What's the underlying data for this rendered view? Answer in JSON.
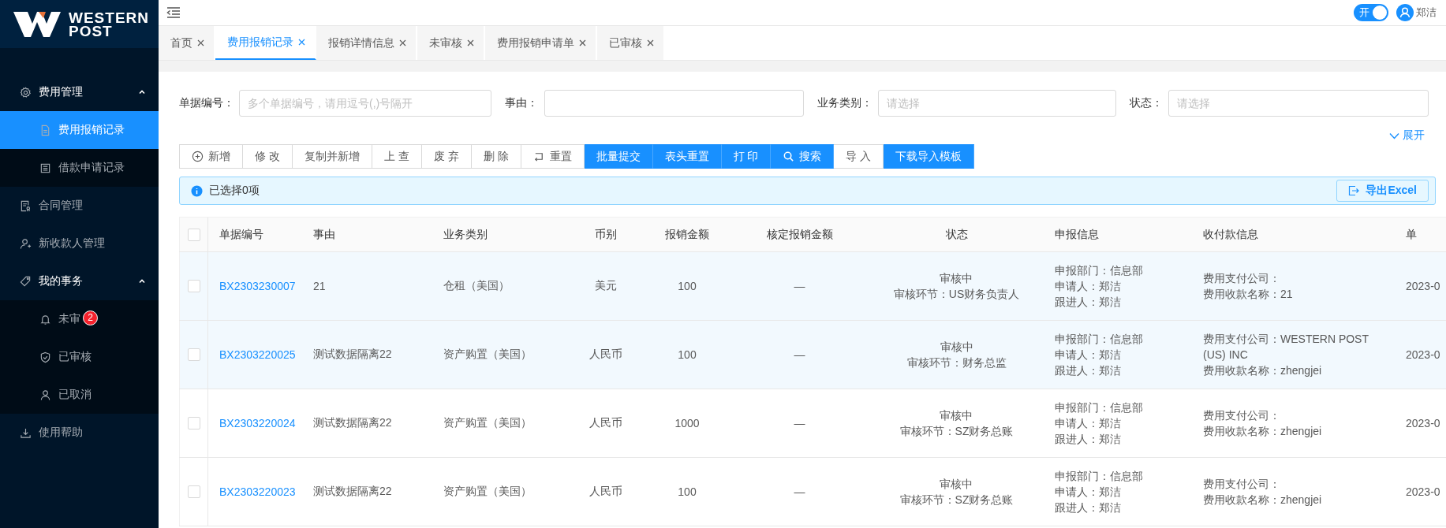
{
  "sidebar": {
    "logo": {
      "line1": "WESTERN",
      "line2": "POST"
    },
    "menu": [
      {
        "kind": "group",
        "label": "费用管理",
        "expanded": true,
        "children": [
          {
            "label": "费用报销记录",
            "selected": true
          },
          {
            "label": "借款申请记录",
            "selected": false
          }
        ]
      },
      {
        "kind": "item",
        "label": "合同管理",
        "selected": false
      },
      {
        "kind": "item",
        "label": "新收款人管理",
        "selected": false
      },
      {
        "kind": "group",
        "label": "我的事务",
        "expanded": true,
        "children": [
          {
            "label": "未审",
            "selected": false,
            "badge": "2"
          },
          {
            "label": "已审核",
            "selected": false
          },
          {
            "label": "已取消",
            "selected": false
          }
        ]
      },
      {
        "kind": "item",
        "label": "使用帮助",
        "selected": false
      }
    ]
  },
  "header": {
    "toggle": {
      "label": "开",
      "on": true
    },
    "user": {
      "name": "郑洁"
    }
  },
  "tabs": [
    {
      "label": "首页",
      "selected": false
    },
    {
      "label": "费用报销记录",
      "selected": true
    },
    {
      "label": "报销详情信息",
      "selected": false
    },
    {
      "label": "未审核",
      "selected": false
    },
    {
      "label": "费用报销申请单",
      "selected": false
    },
    {
      "label": "已审核",
      "selected": false
    }
  ],
  "filters": [
    {
      "label": "单据编号：",
      "placeholder": "多个单据编号，请用逗号(,)号隔开"
    },
    {
      "label": "事由："
    },
    {
      "label": "业务类别：",
      "placeholder": "请选择"
    },
    {
      "label": "状态：",
      "placeholder": "请选择"
    }
  ],
  "expand_link": "展开",
  "toolbar": [
    {
      "label": "新增",
      "kind": "default"
    },
    {
      "label": "修 改",
      "kind": "default"
    },
    {
      "label": "复制并新增",
      "kind": "default"
    },
    {
      "label": "上 查",
      "kind": "default"
    },
    {
      "label": "废 弃",
      "kind": "default"
    },
    {
      "label": "删 除",
      "kind": "default"
    },
    {
      "label": "重置",
      "kind": "default"
    },
    {
      "label": "批量提交",
      "kind": "primary"
    },
    {
      "label": "表头重置",
      "kind": "primary"
    },
    {
      "label": "打 印",
      "kind": "primary"
    },
    {
      "label": "搜索",
      "kind": "primary"
    },
    {
      "label": "导 入",
      "kind": "default"
    },
    {
      "label": "下载导入模板",
      "kind": "primary"
    }
  ],
  "alert": {
    "text": "已选择0项",
    "button": "导出Excel"
  },
  "table": {
    "header_checked": false,
    "columns": [
      "单据编号",
      "事由",
      "业务类别",
      "币别",
      "报销金额",
      "核定报销金额",
      "状态",
      "申报信息",
      "收付款信息",
      "单"
    ],
    "rows": [
      {
        "checked": false,
        "highlighted": true,
        "no": "BX2303230007",
        "reason": "21",
        "biz_type": "仓租（美国）",
        "currency": "美元",
        "amount": "100",
        "approved": "—",
        "status": "审核中",
        "stage": "审核环节：US财务负责人",
        "declare": [
          "申报部门：信息部",
          "申请人：郑洁",
          "跟进人：郑洁"
        ],
        "payment": [
          "费用支付公司：",
          "费用收款名称：21"
        ],
        "column_10": "2023-0"
      },
      {
        "checked": false,
        "highlighted": true,
        "no": "BX2303220025",
        "reason": "测试数据隔离22",
        "biz_type": "资产购置（美国）",
        "currency": "人民币",
        "amount": "100",
        "approved": "—",
        "status": "审核中",
        "stage": "审核环节：财务总监",
        "declare": [
          "申报部门：信息部",
          "申请人：郑洁",
          "跟进人：郑洁"
        ],
        "payment": [
          "费用支付公司：WESTERN POST (US) INC",
          "费用收款名称：zhengjei"
        ],
        "column_10": "2023-0"
      },
      {
        "checked": false,
        "highlighted": false,
        "no": "BX2303220024",
        "reason": "测试数据隔离22",
        "biz_type": "资产购置（美国）",
        "currency": "人民币",
        "amount": "1000",
        "approved": "—",
        "status": "审核中",
        "stage": "审核环节：SZ财务总账",
        "declare": [
          "申报部门：信息部",
          "申请人：郑洁",
          "跟进人：郑洁"
        ],
        "payment": [
          "费用支付公司：",
          "费用收款名称：zhengjei"
        ],
        "column_10": "2023-0"
      },
      {
        "checked": false,
        "highlighted": false,
        "no": "BX2303220023",
        "reason": "测试数据隔离22",
        "biz_type": "资产购置（美国）",
        "currency": "人民币",
        "amount": "100",
        "approved": "—",
        "status": "审核中",
        "stage": "审核环节：SZ财务总账",
        "declare": [
          "申报部门：信息部",
          "申请人：郑洁",
          "跟进人：郑洁"
        ],
        "payment": [
          "费用支付公司：",
          "费用收款名称：zhengjei"
        ],
        "column_10": "2023-0"
      }
    ]
  }
}
